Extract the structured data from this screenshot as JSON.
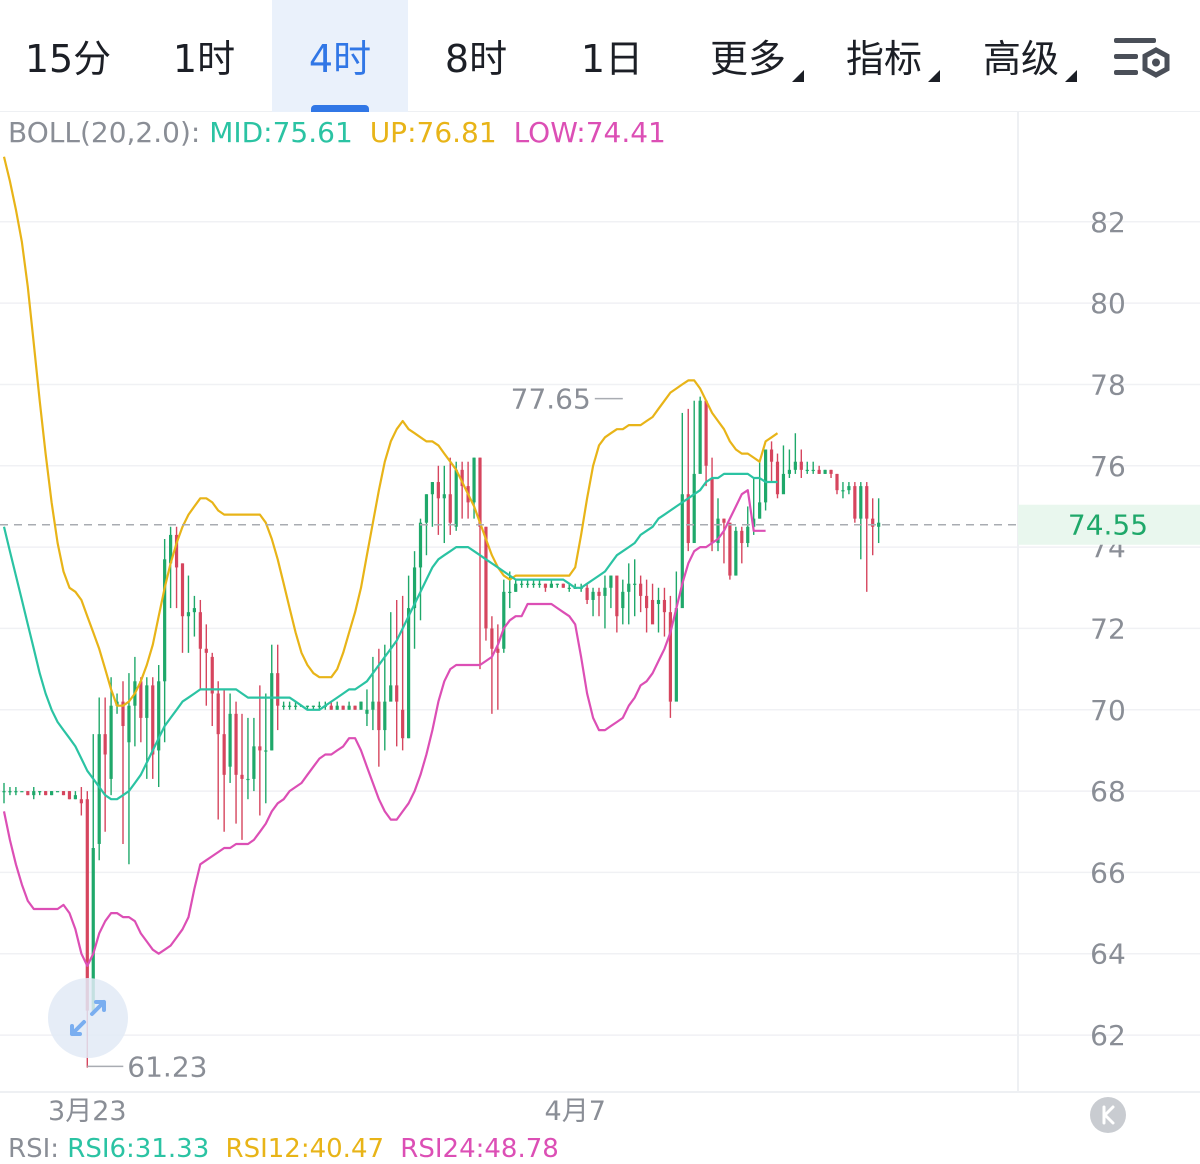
{
  "tabs": [
    {
      "label": "15分",
      "active": false,
      "dropdown": false
    },
    {
      "label": "1时",
      "active": false,
      "dropdown": false
    },
    {
      "label": "4时",
      "active": true,
      "dropdown": false
    },
    {
      "label": "8时",
      "active": false,
      "dropdown": false
    },
    {
      "label": "1日",
      "active": false,
      "dropdown": false
    },
    {
      "label": "更多",
      "active": false,
      "dropdown": true
    },
    {
      "label": "指标",
      "active": false,
      "dropdown": true
    },
    {
      "label": "高级",
      "active": false,
      "dropdown": true
    }
  ],
  "settings_icon": "chart-settings-icon",
  "boll": {
    "prefix": "BOLL(20,2.0):",
    "mid": "MID:75.61",
    "up": "UP:76.81",
    "low": "LOW:74.41"
  },
  "rsi": {
    "prefix": "RSI:",
    "rsi6": "RSI6:31.33",
    "rsi12": "RSI12:40.47",
    "rsi24": "RSI24:48.78"
  },
  "colors": {
    "up_candle": "#1fa86a",
    "down_candle": "#d6455e",
    "boll_mid": "#2bc3a3",
    "boll_up": "#e8b418",
    "boll_low": "#dc4fb5",
    "accent": "#3177e6",
    "last_price_bg": "#e9f7ee"
  },
  "reset_icon": "reset-view-icon",
  "zoom_icon": "expand-icon",
  "chart_data": {
    "type": "candlestick",
    "interval": "4时",
    "y_ticks": [
      "82",
      "80",
      "78",
      "76",
      "74",
      "72",
      "70",
      "68",
      "66",
      "64",
      "62"
    ],
    "ylim": [
      60.6,
      84.7
    ],
    "x_labels": [
      {
        "text": "3月23",
        "index": 14
      },
      {
        "text": "4月7",
        "index": 96
      }
    ],
    "last_price": "74.55",
    "last_price_value": 74.55,
    "high_marker": {
      "text": "77.65",
      "index": 104,
      "value": 77.65
    },
    "low_marker": {
      "text": "61.23",
      "index": 14,
      "value": 61.23
    },
    "grid": true,
    "series_upper": [
      83.6,
      83.0,
      82.3,
      81.5,
      80.4,
      79.0,
      77.6,
      76.3,
      75.1,
      74.1,
      73.4,
      73.0,
      72.9,
      72.7,
      72.3,
      71.9,
      71.5,
      71.0,
      70.5,
      70.1,
      70.1,
      70.2,
      70.4,
      70.7,
      71.1,
      71.6,
      72.3,
      73.0,
      73.6,
      74.1,
      74.5,
      74.8,
      75.0,
      75.2,
      75.2,
      75.1,
      74.9,
      74.8,
      74.8,
      74.8,
      74.8,
      74.8,
      74.8,
      74.8,
      74.6,
      74.2,
      73.7,
      73.1,
      72.5,
      71.9,
      71.4,
      71.1,
      70.9,
      70.8,
      70.8,
      70.8,
      71.0,
      71.4,
      71.9,
      72.4,
      73.0,
      73.8,
      74.6,
      75.4,
      76.1,
      76.6,
      76.9,
      77.1,
      76.9,
      76.8,
      76.7,
      76.6,
      76.6,
      76.5,
      76.3,
      76.1,
      75.9,
      75.6,
      75.3,
      75.0,
      74.6,
      74.2,
      73.8,
      73.5,
      73.3,
      73.2,
      73.3,
      73.3,
      73.3,
      73.3,
      73.3,
      73.3,
      73.3,
      73.3,
      73.3,
      73.3,
      73.5,
      74.3,
      75.2,
      76.0,
      76.5,
      76.7,
      76.8,
      76.9,
      76.9,
      77.0,
      77.0,
      77.0,
      77.1,
      77.2,
      77.4,
      77.6,
      77.8,
      77.9,
      78.0,
      78.1,
      78.1,
      77.9,
      77.6,
      77.3,
      77.1,
      76.9,
      76.6,
      76.4,
      76.3,
      76.3,
      76.2,
      76.1,
      76.6,
      76.7,
      76.8
    ],
    "series_mid": [
      74.5,
      73.9,
      73.3,
      72.7,
      72.1,
      71.5,
      70.9,
      70.4,
      70.0,
      69.7,
      69.5,
      69.3,
      69.1,
      68.8,
      68.5,
      68.3,
      68.1,
      67.9,
      67.8,
      67.8,
      67.9,
      68.0,
      68.2,
      68.4,
      68.7,
      69.0,
      69.3,
      69.6,
      69.8,
      70.0,
      70.2,
      70.3,
      70.4,
      70.5,
      70.5,
      70.5,
      70.5,
      70.5,
      70.5,
      70.5,
      70.4,
      70.3,
      70.3,
      70.3,
      70.3,
      70.3,
      70.3,
      70.3,
      70.3,
      70.2,
      70.1,
      70.0,
      70.0,
      70.0,
      70.1,
      70.2,
      70.3,
      70.4,
      70.5,
      70.5,
      70.6,
      70.7,
      70.9,
      71.1,
      71.3,
      71.5,
      71.7,
      72.0,
      72.3,
      72.6,
      72.9,
      73.2,
      73.5,
      73.7,
      73.8,
      73.9,
      74.0,
      74.0,
      74.0,
      73.9,
      73.8,
      73.7,
      73.6,
      73.5,
      73.4,
      73.3,
      73.2,
      73.2,
      73.2,
      73.2,
      73.2,
      73.2,
      73.2,
      73.2,
      73.2,
      73.1,
      73.0,
      73.0,
      73.1,
      73.2,
      73.3,
      73.4,
      73.6,
      73.8,
      73.9,
      74.0,
      74.1,
      74.3,
      74.4,
      74.5,
      74.7,
      74.8,
      74.9,
      75.0,
      75.1,
      75.2,
      75.3,
      75.4,
      75.6,
      75.7,
      75.7,
      75.8,
      75.8,
      75.8,
      75.8,
      75.8,
      75.7,
      75.7,
      75.6,
      75.6,
      75.6
    ],
    "series_lower": [
      67.5,
      66.8,
      66.2,
      65.7,
      65.3,
      65.1,
      65.1,
      65.1,
      65.1,
      65.1,
      65.2,
      65.0,
      64.6,
      64.0,
      63.7,
      64.0,
      64.5,
      64.8,
      65.0,
      65.0,
      64.9,
      64.9,
      64.8,
      64.5,
      64.3,
      64.1,
      64.0,
      64.1,
      64.2,
      64.4,
      64.6,
      64.9,
      65.6,
      66.2,
      66.3,
      66.4,
      66.5,
      66.6,
      66.6,
      66.7,
      66.7,
      66.7,
      66.8,
      67.0,
      67.2,
      67.5,
      67.7,
      67.8,
      68.0,
      68.1,
      68.2,
      68.4,
      68.6,
      68.8,
      68.9,
      68.9,
      69.0,
      69.1,
      69.3,
      69.3,
      69.0,
      68.6,
      68.2,
      67.8,
      67.5,
      67.3,
      67.3,
      67.5,
      67.7,
      68.0,
      68.4,
      68.9,
      69.5,
      70.2,
      70.7,
      71.0,
      71.1,
      71.1,
      71.1,
      71.1,
      71.1,
      71.2,
      71.3,
      71.6,
      72.0,
      72.2,
      72.3,
      72.3,
      72.6,
      72.6,
      72.6,
      72.6,
      72.6,
      72.5,
      72.4,
      72.3,
      72.1,
      71.3,
      70.4,
      69.8,
      69.5,
      69.5,
      69.6,
      69.7,
      69.8,
      70.1,
      70.3,
      70.6,
      70.7,
      70.9,
      71.2,
      71.5,
      71.9,
      72.5,
      73.1,
      73.6,
      73.9,
      74.0,
      74.0,
      74.1,
      74.2,
      74.4,
      74.7,
      75.0,
      75.3,
      75.4,
      74.4,
      74.4,
      74.4
    ],
    "candles": [
      [
        68.0,
        68.0,
        68.2,
        67.7
      ],
      [
        68.0,
        68.0,
        68.1,
        67.9
      ],
      [
        68.0,
        68.0,
        68.1,
        67.9
      ],
      [
        68.0,
        68.0,
        68.0,
        68.0
      ],
      [
        68.0,
        67.9,
        68.0,
        67.9
      ],
      [
        67.9,
        68.0,
        68.1,
        67.8
      ],
      [
        68.0,
        68.0,
        68.0,
        67.9
      ],
      [
        68.0,
        67.9,
        68.0,
        67.9
      ],
      [
        67.9,
        68.0,
        68.0,
        67.9
      ],
      [
        68.0,
        68.0,
        68.0,
        68.0
      ],
      [
        68.0,
        67.9,
        68.0,
        67.9
      ],
      [
        68.0,
        67.8,
        68.0,
        67.8
      ],
      [
        67.8,
        67.9,
        68.0,
        67.8
      ],
      [
        67.8,
        67.7,
        68.1,
        67.4
      ],
      [
        67.8,
        62.6,
        68.0,
        61.2
      ],
      [
        62.6,
        66.6,
        69.4,
        63.2
      ],
      [
        66.7,
        69.4,
        70.3,
        66.3
      ],
      [
        69.4,
        68.9,
        70.3,
        67.0
      ],
      [
        68.3,
        70.1,
        70.8,
        67.9
      ],
      [
        70.1,
        70.2,
        70.4,
        69.9
      ],
      [
        70.2,
        69.6,
        70.7,
        66.7
      ],
      [
        69.2,
        70.1,
        70.9,
        66.2
      ],
      [
        70.1,
        70.7,
        71.3,
        69.1
      ],
      [
        70.7,
        69.8,
        70.8,
        69.2
      ],
      [
        69.8,
        70.6,
        70.8,
        68.3
      ],
      [
        70.6,
        68.9,
        70.8,
        68.3
      ],
      [
        69.0,
        70.7,
        71.1,
        68.1
      ],
      [
        70.7,
        73.7,
        74.2,
        69.2
      ],
      [
        73.6,
        74.3,
        74.5,
        72.5
      ],
      [
        74.3,
        73.5,
        74.5,
        72.5
      ],
      [
        73.6,
        72.3,
        73.6,
        71.4
      ],
      [
        72.3,
        72.4,
        73.3,
        71.4
      ],
      [
        72.4,
        72.5,
        72.8,
        71.8
      ],
      [
        72.4,
        71.5,
        72.7,
        70.5
      ],
      [
        71.5,
        71.4,
        72.1,
        70.1
      ],
      [
        71.3,
        70.4,
        71.4,
        69.6
      ],
      [
        70.4,
        69.4,
        70.7,
        67.3
      ],
      [
        69.4,
        68.4,
        70.5,
        67.0
      ],
      [
        68.6,
        69.9,
        70.4,
        68.2
      ],
      [
        69.9,
        68.4,
        70.2,
        67.2
      ],
      [
        68.4,
        68.3,
        69.9,
        66.8
      ],
      [
        68.3,
        68.3,
        69.8,
        67.8
      ],
      [
        68.3,
        69.1,
        69.8,
        68.0
      ],
      [
        69.1,
        69.0,
        70.6,
        67.4
      ],
      [
        69.0,
        69.0,
        70.4,
        67.7
      ],
      [
        69.0,
        70.9,
        71.6,
        69.0
      ],
      [
        70.9,
        70.1,
        71.6,
        69.5
      ],
      [
        70.1,
        70.1,
        70.2,
        70.0
      ],
      [
        70.1,
        70.1,
        70.2,
        70.0
      ],
      [
        70.1,
        70.1,
        70.2,
        70.0
      ],
      [
        70.1,
        70.1,
        70.1,
        70.1
      ],
      [
        70.1,
        70.1,
        70.1,
        70.0
      ],
      [
        70.1,
        70.1,
        70.1,
        70.0
      ],
      [
        70.1,
        70.1,
        70.2,
        70.0
      ],
      [
        70.1,
        70.1,
        70.2,
        70.0
      ],
      [
        70.1,
        70.0,
        70.2,
        70.0
      ],
      [
        70.0,
        70.1,
        70.2,
        70.0
      ],
      [
        70.1,
        70.0,
        70.1,
        70.0
      ],
      [
        70.0,
        70.1,
        70.2,
        70.0
      ],
      [
        70.1,
        70.0,
        70.1,
        70.0
      ],
      [
        70.0,
        70.2,
        70.2,
        70.0
      ],
      [
        69.9,
        70.0,
        70.5,
        69.6
      ],
      [
        70.0,
        70.2,
        71.3,
        69.5
      ],
      [
        70.2,
        69.5,
        71.5,
        68.6
      ],
      [
        69.5,
        70.2,
        71.6,
        69.0
      ],
      [
        70.2,
        70.6,
        72.4,
        70.3
      ],
      [
        70.6,
        70.2,
        72.7,
        69.1
      ],
      [
        70.0,
        69.3,
        72.8,
        69.0
      ],
      [
        69.3,
        72.5,
        73.3,
        69.3
      ],
      [
        72.5,
        73.5,
        73.9,
        71.5
      ],
      [
        73.5,
        74.6,
        74.7,
        72.2
      ],
      [
        74.6,
        75.3,
        75.3,
        73.8
      ],
      [
        75.3,
        75.6,
        75.6,
        74.5
      ],
      [
        75.6,
        75.2,
        76.0,
        74.3
      ],
      [
        75.2,
        75.3,
        76.0,
        74.1
      ],
      [
        75.3,
        74.6,
        76.2,
        74.3
      ],
      [
        74.5,
        75.9,
        76.1,
        74.4
      ],
      [
        75.9,
        75.5,
        76.1,
        74.7
      ],
      [
        75.5,
        75.1,
        76.1,
        74.7
      ],
      [
        75.1,
        76.2,
        76.2,
        74.7
      ],
      [
        76.2,
        74.5,
        76.2,
        71.0
      ],
      [
        74.5,
        72.0,
        74.5,
        71.7
      ],
      [
        72.0,
        71.5,
        72.3,
        69.9
      ],
      [
        71.5,
        71.4,
        72.1,
        70.0
      ],
      [
        71.5,
        72.9,
        73.2,
        71.4
      ],
      [
        72.9,
        72.9,
        73.4,
        72.5
      ],
      [
        72.9,
        73.1,
        73.2,
        72.9
      ],
      [
        73.1,
        73.1,
        73.2,
        73.0
      ],
      [
        73.1,
        73.1,
        73.2,
        73.0
      ],
      [
        73.1,
        73.1,
        73.2,
        73.0
      ],
      [
        73.1,
        73.1,
        73.2,
        73.0
      ],
      [
        73.1,
        73.0,
        73.1,
        72.9
      ],
      [
        73.0,
        73.1,
        73.2,
        73.0
      ],
      [
        73.1,
        73.1,
        73.1,
        73.0
      ],
      [
        73.1,
        73.0,
        73.1,
        73.0
      ],
      [
        73.0,
        73.0,
        73.1,
        72.9
      ],
      [
        73.0,
        73.0,
        73.1,
        73.0
      ],
      [
        73.0,
        73.0,
        73.1,
        72.9
      ],
      [
        73.0,
        72.7,
        73.1,
        72.6
      ],
      [
        72.7,
        72.9,
        73.0,
        72.3
      ],
      [
        72.9,
        72.8,
        73.0,
        72.3
      ],
      [
        72.8,
        73.0,
        73.3,
        72.0
      ],
      [
        73.0,
        73.3,
        73.3,
        72.5
      ],
      [
        73.3,
        72.3,
        73.2,
        71.9
      ],
      [
        72.5,
        72.9,
        73.2,
        72.1
      ],
      [
        72.9,
        73.1,
        73.6,
        72.1
      ],
      [
        73.1,
        73.1,
        73.7,
        72.3
      ],
      [
        73.1,
        72.8,
        73.3,
        72.4
      ],
      [
        72.8,
        72.5,
        73.2,
        71.9
      ],
      [
        72.7,
        72.1,
        73.1,
        72.2
      ],
      [
        72.6,
        72.7,
        73.0,
        71.9
      ],
      [
        72.7,
        72.4,
        73.0,
        71.8
      ],
      [
        72.4,
        70.2,
        72.8,
        69.8
      ],
      [
        70.2,
        72.5,
        73.4,
        71.8
      ],
      [
        72.5,
        75.3,
        77.3,
        74.6
      ],
      [
        75.3,
        74.1,
        77.4,
        73.9
      ],
      [
        74.1,
        75.8,
        77.6,
        75.7
      ],
      [
        75.8,
        77.6,
        77.7,
        76.2
      ],
      [
        77.6,
        76.0,
        77.6,
        75.5
      ],
      [
        75.7,
        74.1,
        76.2,
        73.9
      ],
      [
        74.1,
        74.7,
        75.2,
        73.9
      ],
      [
        74.7,
        74.6,
        74.7,
        73.6
      ],
      [
        74.6,
        73.3,
        74.6,
        73.2
      ],
      [
        73.3,
        74.4,
        74.5,
        73.3
      ],
      [
        74.4,
        74.1,
        74.5,
        73.6
      ],
      [
        74.1,
        74.5,
        75.0,
        74.0
      ],
      [
        74.5,
        74.7,
        75.7,
        74.3
      ],
      [
        74.7,
        75.1,
        76.1,
        74.7
      ],
      [
        75.1,
        76.4,
        76.4,
        74.9
      ],
      [
        76.4,
        76.1,
        76.6,
        75.6
      ],
      [
        76.1,
        75.3,
        76.3,
        75.2
      ],
      [
        75.3,
        75.8,
        76.5,
        75.5
      ],
      [
        75.8,
        75.9,
        76.4,
        75.7
      ],
      [
        75.9,
        76.1,
        76.8,
        75.8
      ],
      [
        76.1,
        75.9,
        76.4,
        75.7
      ],
      [
        75.9,
        75.9,
        76.1,
        75.8
      ],
      [
        75.9,
        75.9,
        76.1,
        75.8
      ],
      [
        75.9,
        75.8,
        76.0,
        75.8
      ],
      [
        75.8,
        75.9,
        75.9,
        75.8
      ],
      [
        75.9,
        75.8,
        75.9,
        75.7
      ],
      [
        75.8,
        75.4,
        75.8,
        75.3
      ],
      [
        75.4,
        75.4,
        75.6,
        75.2
      ],
      [
        75.4,
        75.5,
        75.6,
        75.3
      ],
      [
        75.5,
        74.7,
        75.6,
        74.6
      ],
      [
        74.7,
        75.5,
        75.6,
        73.7
      ],
      [
        75.5,
        74.7,
        75.6,
        72.9
      ],
      [
        74.7,
        74.5,
        75.2,
        73.8
      ],
      [
        74.5,
        74.6,
        75.2,
        74.1
      ]
    ]
  }
}
